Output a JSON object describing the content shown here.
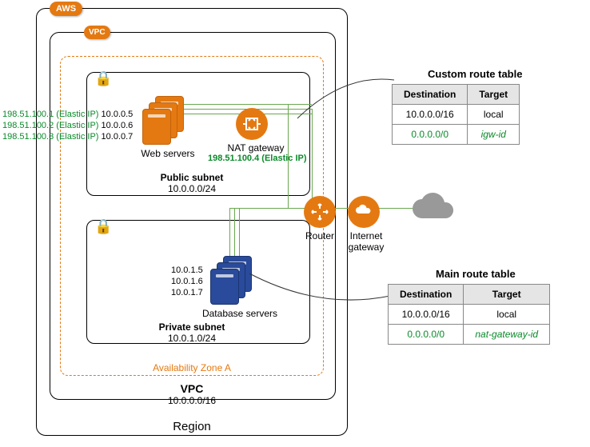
{
  "badges": {
    "aws": "AWS",
    "vpc": "VPC"
  },
  "region_label": "Region",
  "vpc_label": "VPC",
  "vpc_cidr": "10.0.0.0/16",
  "az_label": "Availability Zone A",
  "public_subnet": {
    "title": "Public subnet",
    "cidr": "10.0.0.0/24"
  },
  "private_subnet": {
    "title": "Private  subnet",
    "cidr": "10.0.1.0/24"
  },
  "web_servers_label": "Web servers",
  "db_servers_label": "Database servers",
  "nat_label": "NAT gateway",
  "router_label": "Router",
  "igw_label": "Internet gateway",
  "eips": [
    {
      "public": "198.51.100.1",
      "tag": "(Elastic IP)",
      "private": "10.0.0.5"
    },
    {
      "public": "198.51.100.2",
      "tag": "(Elastic IP)",
      "private": "10.0.0.6"
    },
    {
      "public": "198.51.100.3",
      "tag": "(Elastic IP)",
      "private": "10.0.0.7"
    }
  ],
  "nat_eip": {
    "public": "198.51.100.4",
    "tag": "(Elastic IP)"
  },
  "db_ips": [
    "10.0.1.5",
    "10.0.1.6",
    "10.0.1.7"
  ],
  "custom_table": {
    "title": "Custom route table",
    "headers": {
      "dest": "Destination",
      "target": "Target"
    },
    "rows": [
      {
        "dest": "10.0.0.0/16",
        "target": "local",
        "green": false
      },
      {
        "dest": "0.0.0.0/0",
        "target": "igw-id",
        "green": true
      }
    ]
  },
  "main_table": {
    "title": "Main route table",
    "headers": {
      "dest": "Destination",
      "target": "Target"
    },
    "rows": [
      {
        "dest": "10.0.0.0/16",
        "target": "local",
        "green": false
      },
      {
        "dest": "0.0.0.0/0",
        "target": "nat-gateway-id",
        "green": true
      }
    ]
  }
}
